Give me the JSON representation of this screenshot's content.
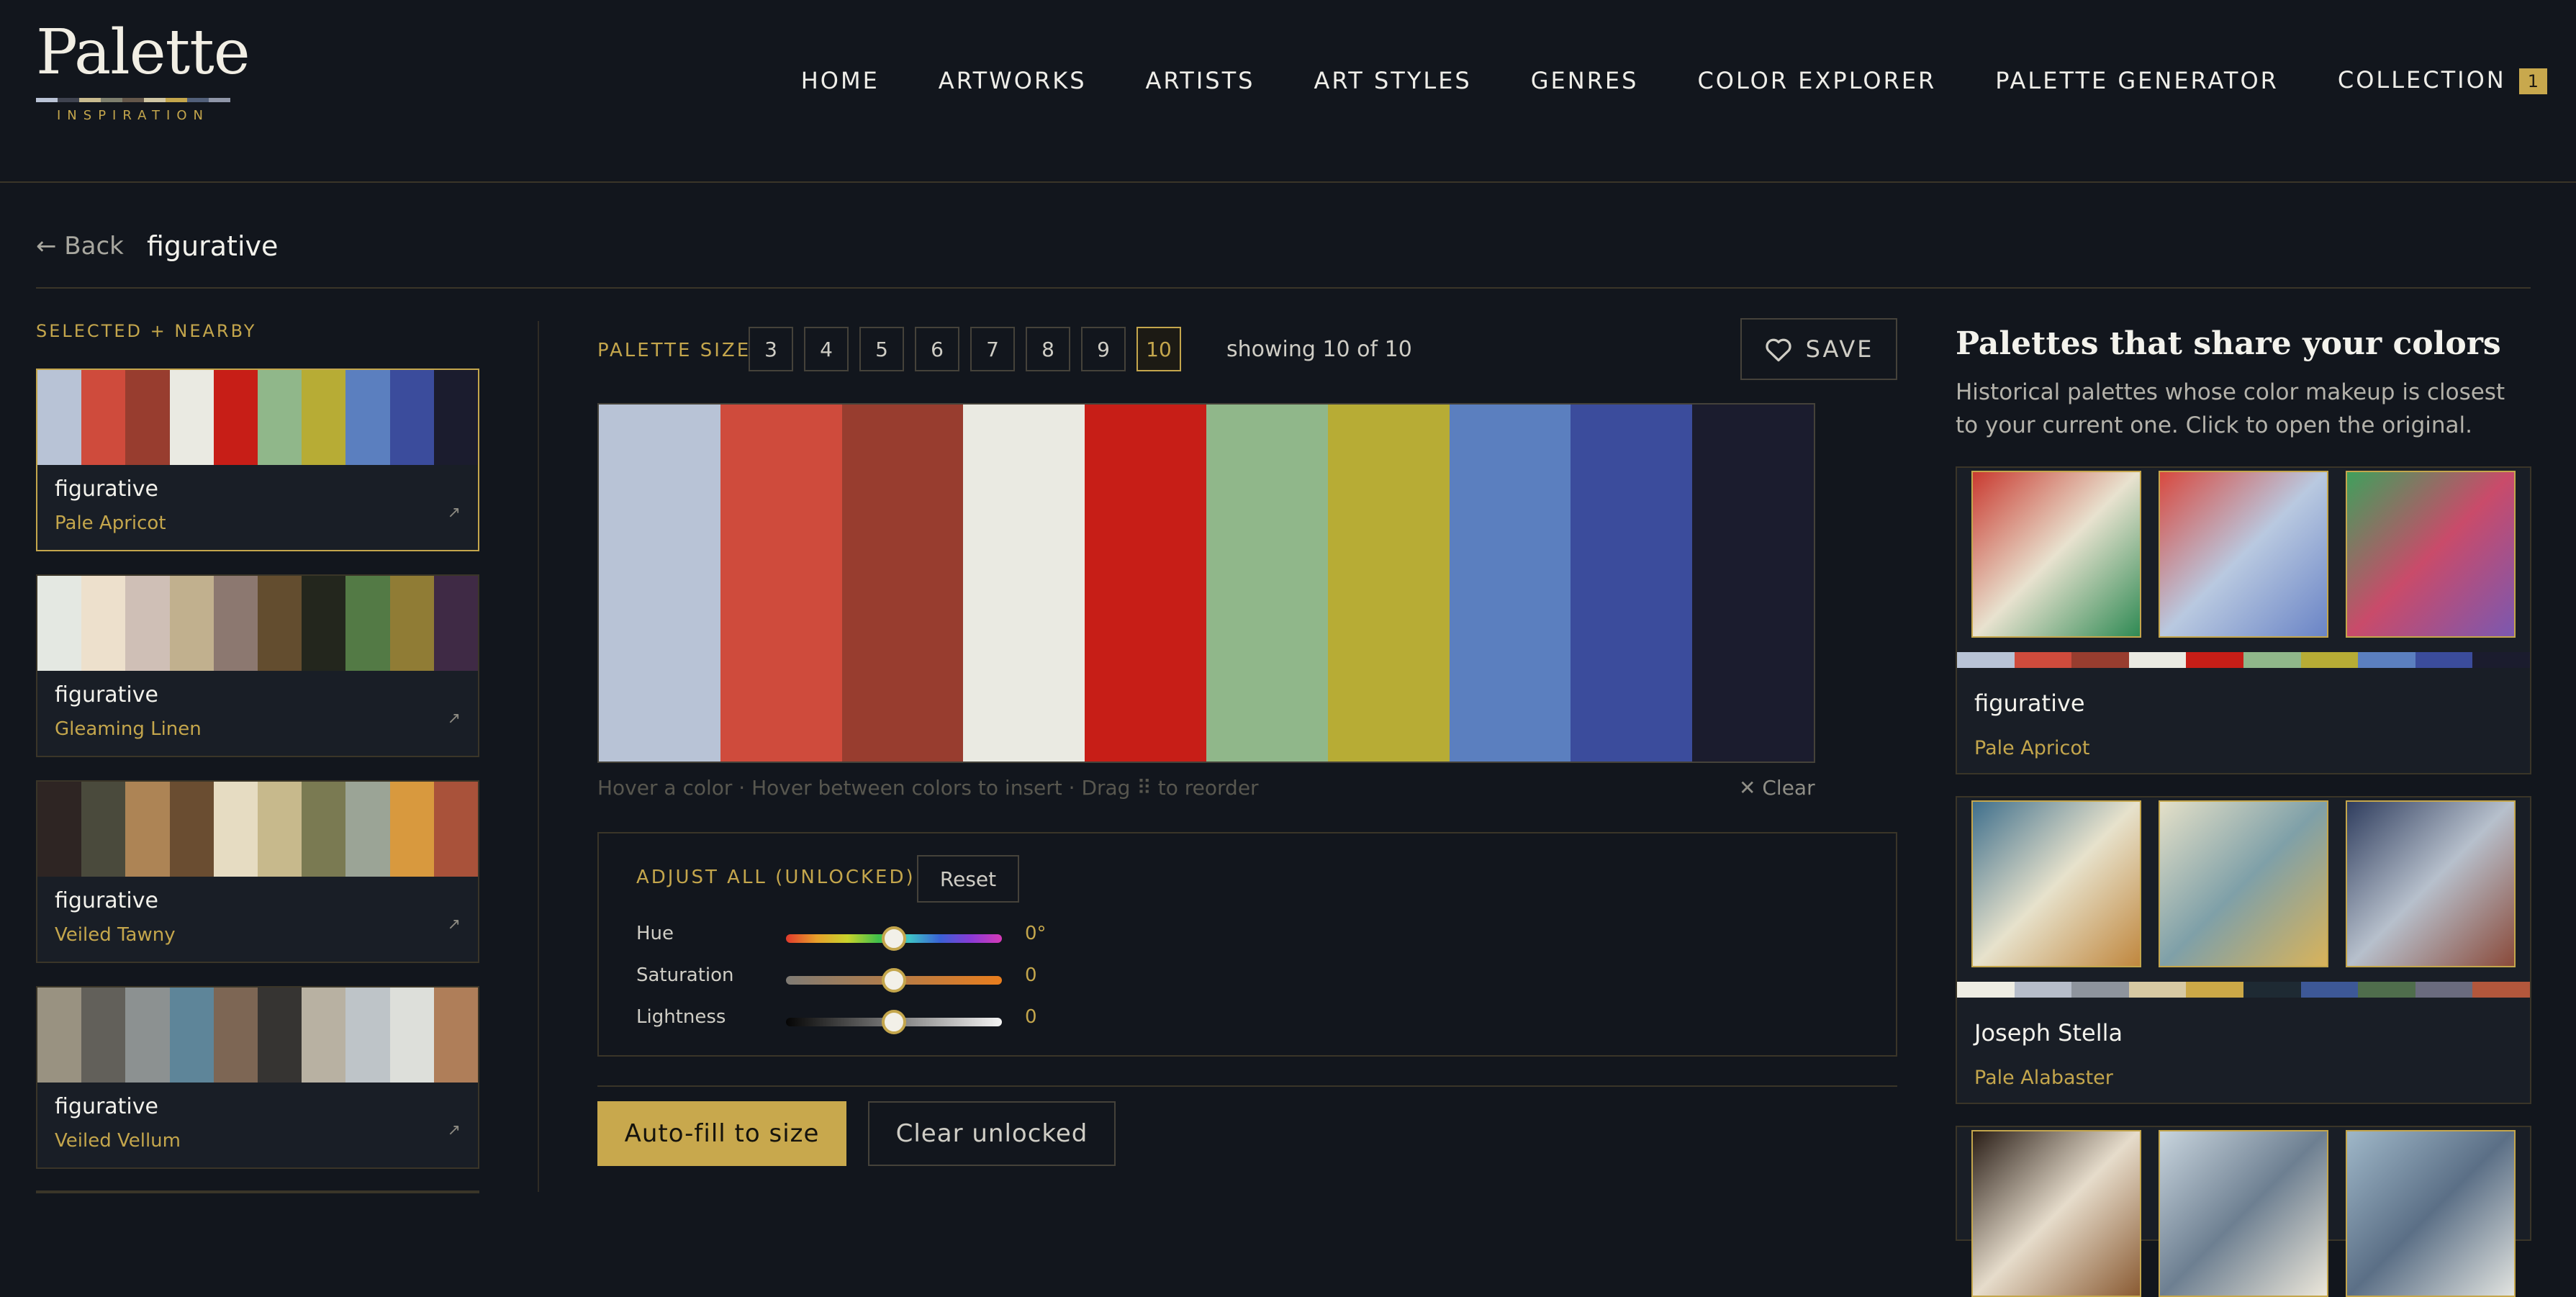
{
  "logo": {
    "title": "Palette",
    "subtitle": "INSPIRATION",
    "strip_colors": [
      "#b9c3d6",
      "#3f4350",
      "#c9bb8f",
      "#7e7f6e",
      "#64574a",
      "#d0c6a4",
      "#c4a64c",
      "#52607a",
      "#8f96a8"
    ]
  },
  "nav": {
    "items": [
      "HOME",
      "ARTWORKS",
      "ARTISTS",
      "ART STYLES",
      "GENRES",
      "COLOR EXPLORER",
      "PALETTE GENERATOR",
      "COLLECTION"
    ],
    "collection_count": "1"
  },
  "breadcrumb": {
    "back_label": "← Back",
    "current": "figurative"
  },
  "sidebar": {
    "section_title": "SELECTED + NEARBY",
    "cards": [
      {
        "name": "figurative",
        "subtitle": "Pale Apricot",
        "selected": true,
        "colors": [
          "#b8c3d6",
          "#cf4b3c",
          "#983d2f",
          "#eaeae2",
          "#c71e17",
          "#90b78a",
          "#b7ac35",
          "#5b7fbf",
          "#3b4c9c",
          "#1b1c2e"
        ]
      },
      {
        "name": "figurative",
        "subtitle": "Gleaming Linen",
        "colors": [
          "#e4e8e2",
          "#ede0cc",
          "#cfbfb6",
          "#c1b08e",
          "#8c7870",
          "#634d2f",
          "#23261d",
          "#537a45",
          "#907c35",
          "#3f2a45"
        ]
      },
      {
        "name": "figurative",
        "subtitle": "Veiled Tawny",
        "colors": [
          "#2e2523",
          "#4a4a3c",
          "#ad8455",
          "#6a4d31",
          "#e6dcc2",
          "#c7b98c",
          "#7a7a52",
          "#9ba496",
          "#d8993e",
          "#a9523a"
        ]
      },
      {
        "name": "figurative",
        "subtitle": "Veiled Vellum",
        "colors": [
          "#999281",
          "#62605a",
          "#8c9191",
          "#5e8599",
          "#7d6654",
          "#363432",
          "#b8b1a2",
          "#bec4c8",
          "#dddfda",
          "#af7e59"
        ]
      }
    ],
    "arrow_glyph": "↗"
  },
  "editor": {
    "palette_size_label": "PALETTE SIZE",
    "sizes": [
      "3",
      "4",
      "5",
      "6",
      "7",
      "8",
      "9",
      "10"
    ],
    "active_size": "10",
    "showing_text": "showing 10 of 10",
    "save_label": "SAVE",
    "palette": [
      "#b8c3d6",
      "#cf4b3c",
      "#983d2f",
      "#eaeae2",
      "#c71e17",
      "#90b78a",
      "#b7ac35",
      "#5b7fbf",
      "#3b4c9c",
      "#1b1c2e"
    ],
    "hint": "Hover a color · Hover between colors to insert · Drag ⠿ to reorder",
    "clear_label": "✕ Clear",
    "adjust": {
      "title": "ADJUST ALL (UNLOCKED)",
      "reset_label": "Reset",
      "sliders": [
        {
          "label": "Hue",
          "value": "0°",
          "position": 0.5
        },
        {
          "label": "Saturation",
          "value": "0",
          "position": 0.5
        },
        {
          "label": "Lightness",
          "value": "0",
          "position": 0.5
        }
      ]
    },
    "autofill_label": "Auto-fill to size",
    "clear_unlocked_label": "Clear unlocked"
  },
  "similar": {
    "title": "Palettes that share your colors",
    "description": "Historical palettes whose color makeup is closest to your current one. Click to open the original.",
    "cards": [
      {
        "name": "figurative",
        "subtitle": "Pale Apricot",
        "art_colors": [
          [
            "#c93a30",
            "#e8e2cf",
            "#2f8a54"
          ],
          [
            "#d8493f",
            "#b9c9e0",
            "#6a84c6"
          ],
          [
            "#3fa05c",
            "#c94b6a",
            "#7b58b0"
          ]
        ],
        "colors": [
          "#b8c3d6",
          "#cf4b3c",
          "#983d2f",
          "#eaeae2",
          "#c71e17",
          "#90b78a",
          "#b7ac35",
          "#5b7fbf",
          "#3b4c9c",
          "#1b1c2e"
        ]
      },
      {
        "name": "Joseph Stella",
        "subtitle": "Pale Alabaster",
        "art_colors": [
          [
            "#3f6f8c",
            "#e7e2cc",
            "#c0873e"
          ],
          [
            "#e4e0c8",
            "#7fa0a8",
            "#d9b35a"
          ],
          [
            "#2f3d5e",
            "#b7c0cc",
            "#8a4a3a"
          ]
        ],
        "colors": [
          "#eeede3",
          "#b6bdca",
          "#8e949d",
          "#d7c9a3",
          "#cba847",
          "#1e2a33",
          "#3d5897",
          "#4f6d4c",
          "#6a6b7e",
          "#b3573c"
        ]
      },
      {
        "name": "",
        "subtitle": "",
        "art_colors": [
          [
            "#2a1e17",
            "#e6dccb",
            "#8a5b33"
          ],
          [
            "#c8d4dd",
            "#6d7f91",
            "#ece7da"
          ],
          [
            "#9fb7c8",
            "#5b6f86",
            "#e2e4e0"
          ]
        ],
        "colors": []
      }
    ]
  }
}
